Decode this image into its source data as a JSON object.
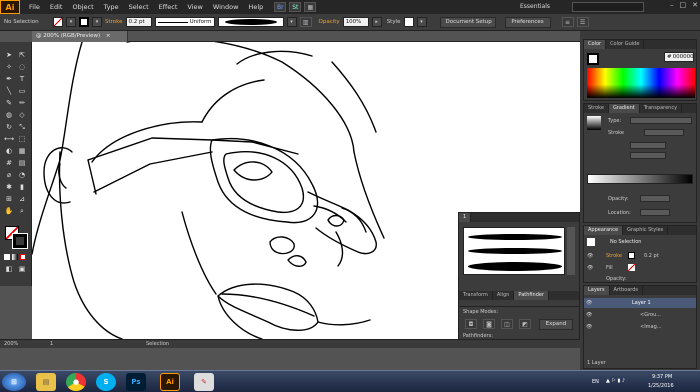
{
  "app": {
    "logo": "Ai",
    "workspace": "Essentials"
  },
  "menu": [
    "File",
    "Edit",
    "Object",
    "Type",
    "Select",
    "Effect",
    "View",
    "Window",
    "Help"
  ],
  "bridge_icons": [
    "Br",
    "St"
  ],
  "control_bar": {
    "selection": "No Selection",
    "stroke_label": "Stroke",
    "stroke_value": "0.2 pt",
    "stroke_profile": "Uniform",
    "opacity_label": "Opacity",
    "opacity_value": "100%",
    "style_label": "Style",
    "document_setup": "Document Setup",
    "preferences": "Preferences"
  },
  "document_tab": {
    "title": "@ 200% (RGB/Preview)"
  },
  "color_panel": {
    "tabs": [
      "Color",
      "Color Guide"
    ],
    "hex": "000000"
  },
  "gradient_panel": {
    "tabs": [
      "Stroke",
      "Gradient",
      "Transparency"
    ],
    "type_label": "Type:",
    "stroke_label": "Stroke",
    "opacity_label": "Opacity:",
    "location_label": "Location:"
  },
  "brushes_panel": {
    "tab": "1"
  },
  "appearance_panel": {
    "tabs": [
      "Appearance",
      "Graphic Styles"
    ],
    "header": "No Selection",
    "stroke_label": "Stroke",
    "stroke_value": "0.2 pt",
    "fill_label": "Fill",
    "opacity_label": "Opacity:",
    "opacity_value": "Default"
  },
  "pathfinder_panel": {
    "tabs": [
      "Transform",
      "Align",
      "Pathfinder"
    ],
    "shape_modes": "Shape Modes:",
    "pathfinders": "Pathfinders:",
    "expand": "Expand"
  },
  "layers_panel": {
    "tabs": [
      "Layers",
      "Artboards"
    ],
    "layers": [
      "Layer 1",
      "<Grou...",
      "<Imag..."
    ],
    "footer": "1 Layer"
  },
  "status_bar": {
    "zoom": "200%",
    "page": "1",
    "tool": "Selection"
  },
  "taskbar": {
    "lang": "EN",
    "time": "9:37 PM",
    "date": "1/25/2016",
    "apps": [
      "start",
      "explorer",
      "chrome",
      "skype",
      "photoshop",
      "illustrator",
      "paint"
    ]
  },
  "colors": {
    "accent": "#ff9a00",
    "panel": "#3c3c3c",
    "canvas": "#ffffff"
  }
}
